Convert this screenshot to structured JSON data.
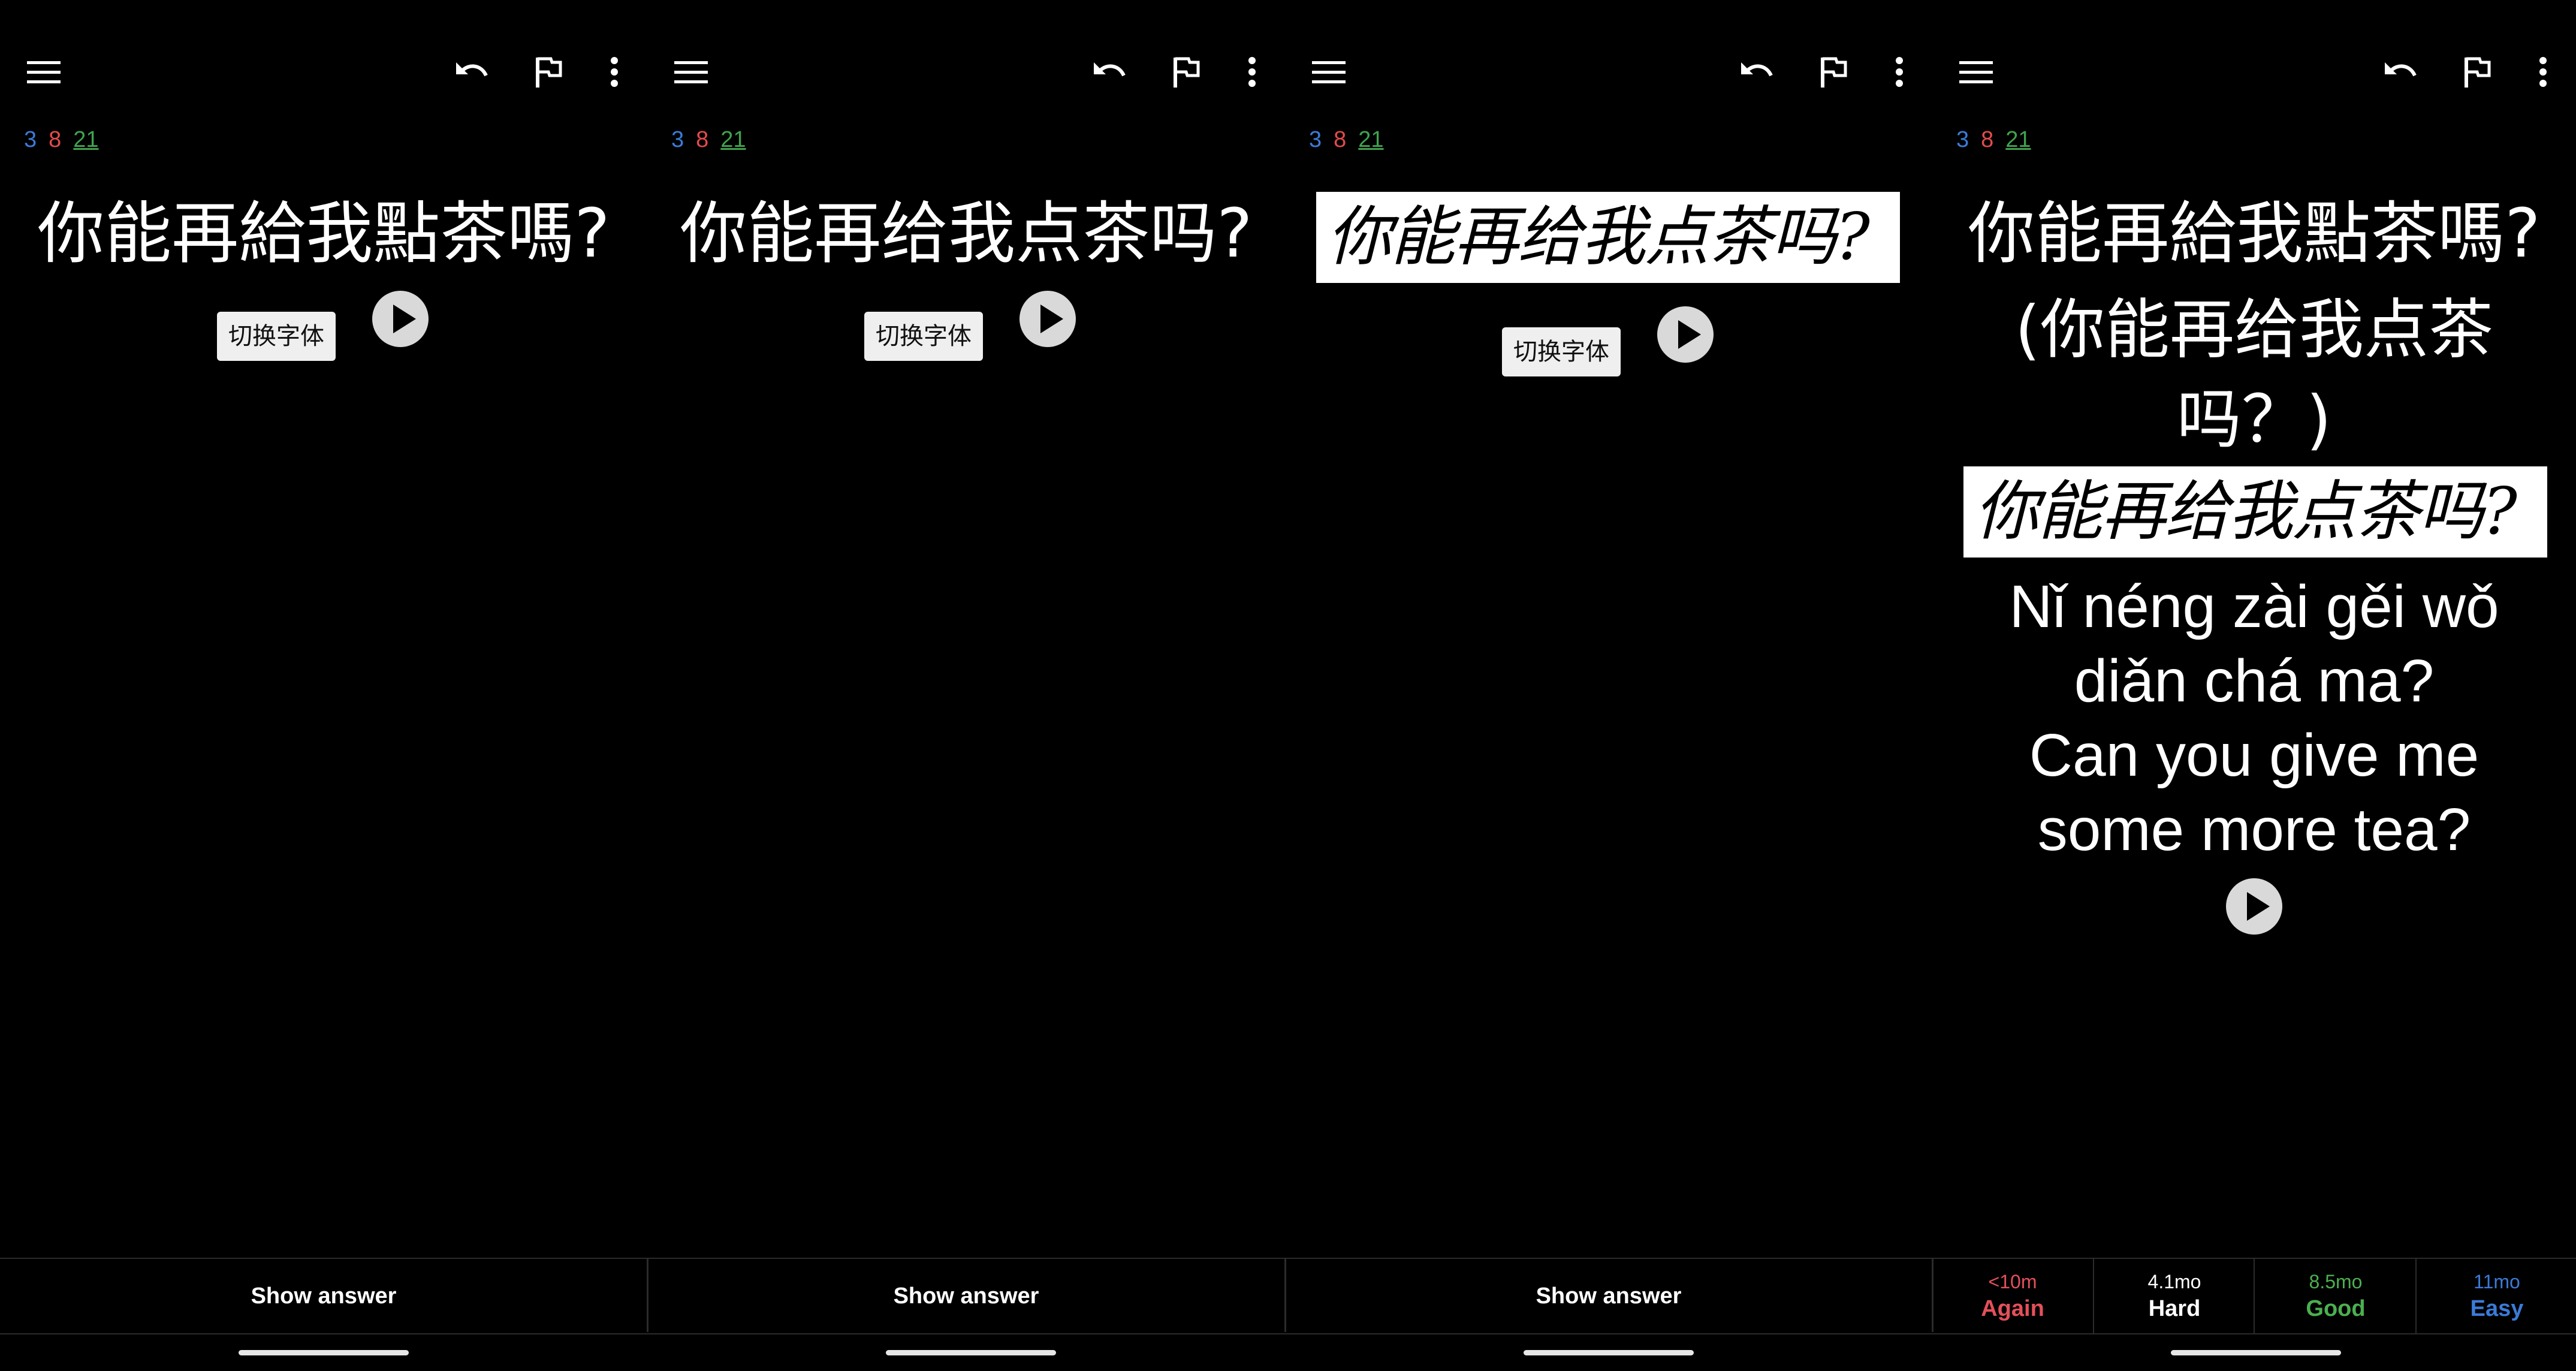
{
  "counts": {
    "new": "3",
    "learning": "8",
    "due": "21"
  },
  "switch_font_label": "切换字体",
  "show_answer_label": "Show answer",
  "panels": [
    {
      "front_text": "你能再給我點茶嗎?"
    },
    {
      "front_text": "你能再给我点茶吗?"
    },
    {
      "front_text": "你能再给我点茶吗?",
      "handwriting": true
    },
    {
      "front_text": "你能再給我點茶嗎?",
      "simplified_line1": "(你能再给我点茶",
      "simplified_line2": "吗？)",
      "handwriting_text": "你能再给我点茶吗?",
      "pinyin_line1": "Nǐ néng zài gěi wǒ",
      "pinyin_line2": "diǎn chá ma?",
      "english_line1": "Can you give me",
      "english_line2": "some more tea?"
    }
  ],
  "ease_buttons": [
    {
      "time": "<10m",
      "label": "Again",
      "color": "#e4505a"
    },
    {
      "time": "4.1mo",
      "label": "Hard",
      "color": "#ffffff"
    },
    {
      "time": "8.5mo",
      "label": "Good",
      "color": "#4caf50"
    },
    {
      "time": "11mo",
      "label": "Easy",
      "color": "#3b7bd8"
    }
  ],
  "icons": [
    "menu-icon",
    "undo-icon",
    "flag-icon",
    "more-vert-icon",
    "play-icon"
  ]
}
